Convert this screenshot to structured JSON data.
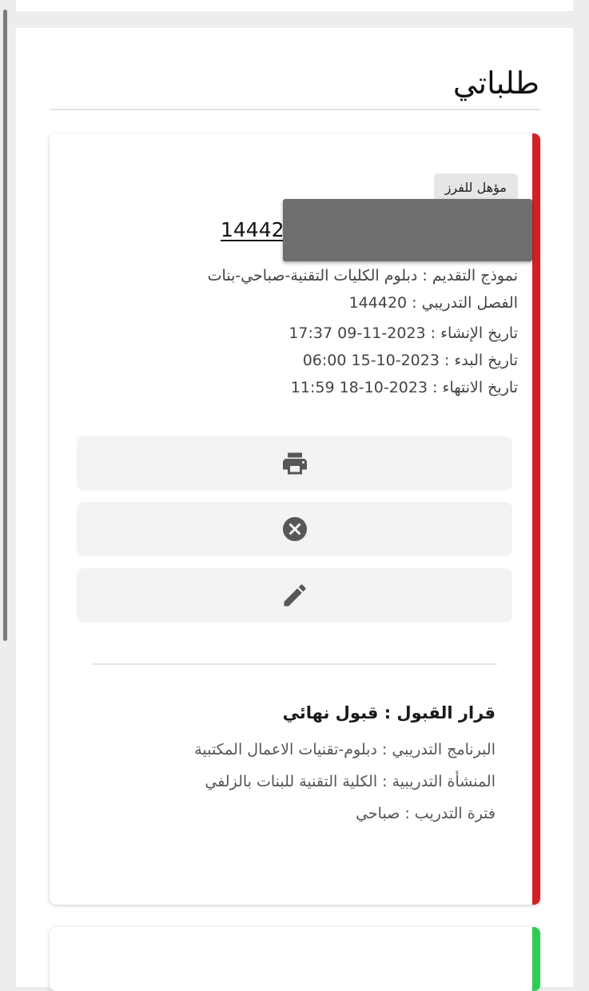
{
  "page": {
    "title": "طلباتي"
  },
  "application": {
    "badge": "مؤهل للفرز",
    "number_visible": "14442",
    "form": "نموذج التقديم : دبلوم الكليات التقنية-صباحي-بنات",
    "term": "الفصل التدريبي : 144420",
    "created": "تاريخ الإنشاء : 2023-11-09 17:37",
    "start": "تاريخ البدء : 2023-10-15 06:00",
    "end": "تاريخ الانتهاء : 2023-10-18 11:59",
    "actions": [
      {
        "name": "print",
        "icon": "printer-icon"
      },
      {
        "name": "cancel",
        "icon": "close-circle-icon"
      },
      {
        "name": "edit",
        "icon": "pencil-icon"
      }
    ],
    "decision": {
      "title": "قرار القبول : قبول نهائي",
      "program": "البرنامج التدريبي : دبلوم-تقنيات الاعمال المكتبية",
      "facility": "المنشأة التدريبية : الكلية التقنية للبنات بالزلفي",
      "period": "فترة التدريب : صباحي"
    },
    "accent_color": "#d42027"
  },
  "next_card": {
    "accent_color": "#2ecc55"
  }
}
